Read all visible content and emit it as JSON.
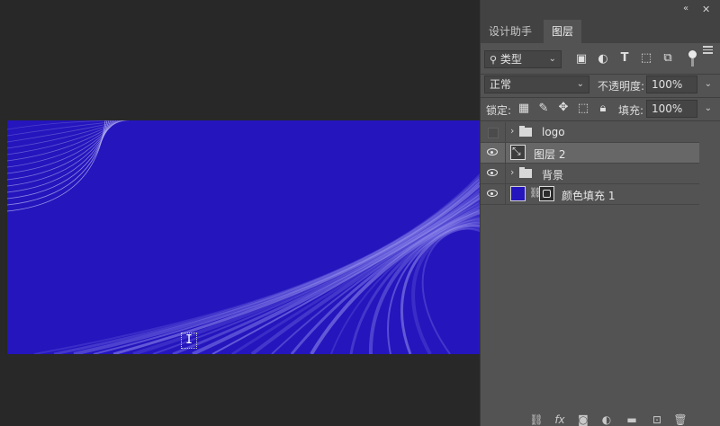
{
  "panel": {
    "collapse_icon": "«",
    "close_icon": "✕",
    "tabs": [
      {
        "label": "设计助手",
        "active": false
      },
      {
        "label": "图层",
        "active": true
      }
    ],
    "filter": {
      "kind_label": "类型",
      "icons": [
        "image-icon",
        "adjustment-icon",
        "type-icon",
        "shape-icon",
        "smart-object-icon"
      ]
    },
    "blend": {
      "mode": "正常",
      "opacity_label": "不透明度:",
      "opacity_value": "100%"
    },
    "lock": {
      "label": "锁定:",
      "fill_label": "填充:",
      "fill_value": "100%"
    },
    "layers": [
      {
        "name": "logo",
        "type": "group",
        "visible": false,
        "selected": false
      },
      {
        "name": "图层 2",
        "type": "pixel",
        "visible": true,
        "selected": true
      },
      {
        "name": "背景",
        "type": "group",
        "visible": true,
        "selected": false
      },
      {
        "name": "颜色填充 1",
        "type": "fill",
        "visible": true,
        "selected": false,
        "fill_color": "#2415bd"
      }
    ],
    "footer_icons": [
      "link-layers-icon",
      "fx-icon",
      "add-mask-icon",
      "new-adjustment-icon",
      "new-group-icon",
      "new-layer-icon",
      "delete-icon"
    ],
    "footer_labels": {
      "fx": "fx"
    }
  },
  "canvas": {
    "background_color": "#2415bd",
    "cursor_glyph": "I"
  }
}
